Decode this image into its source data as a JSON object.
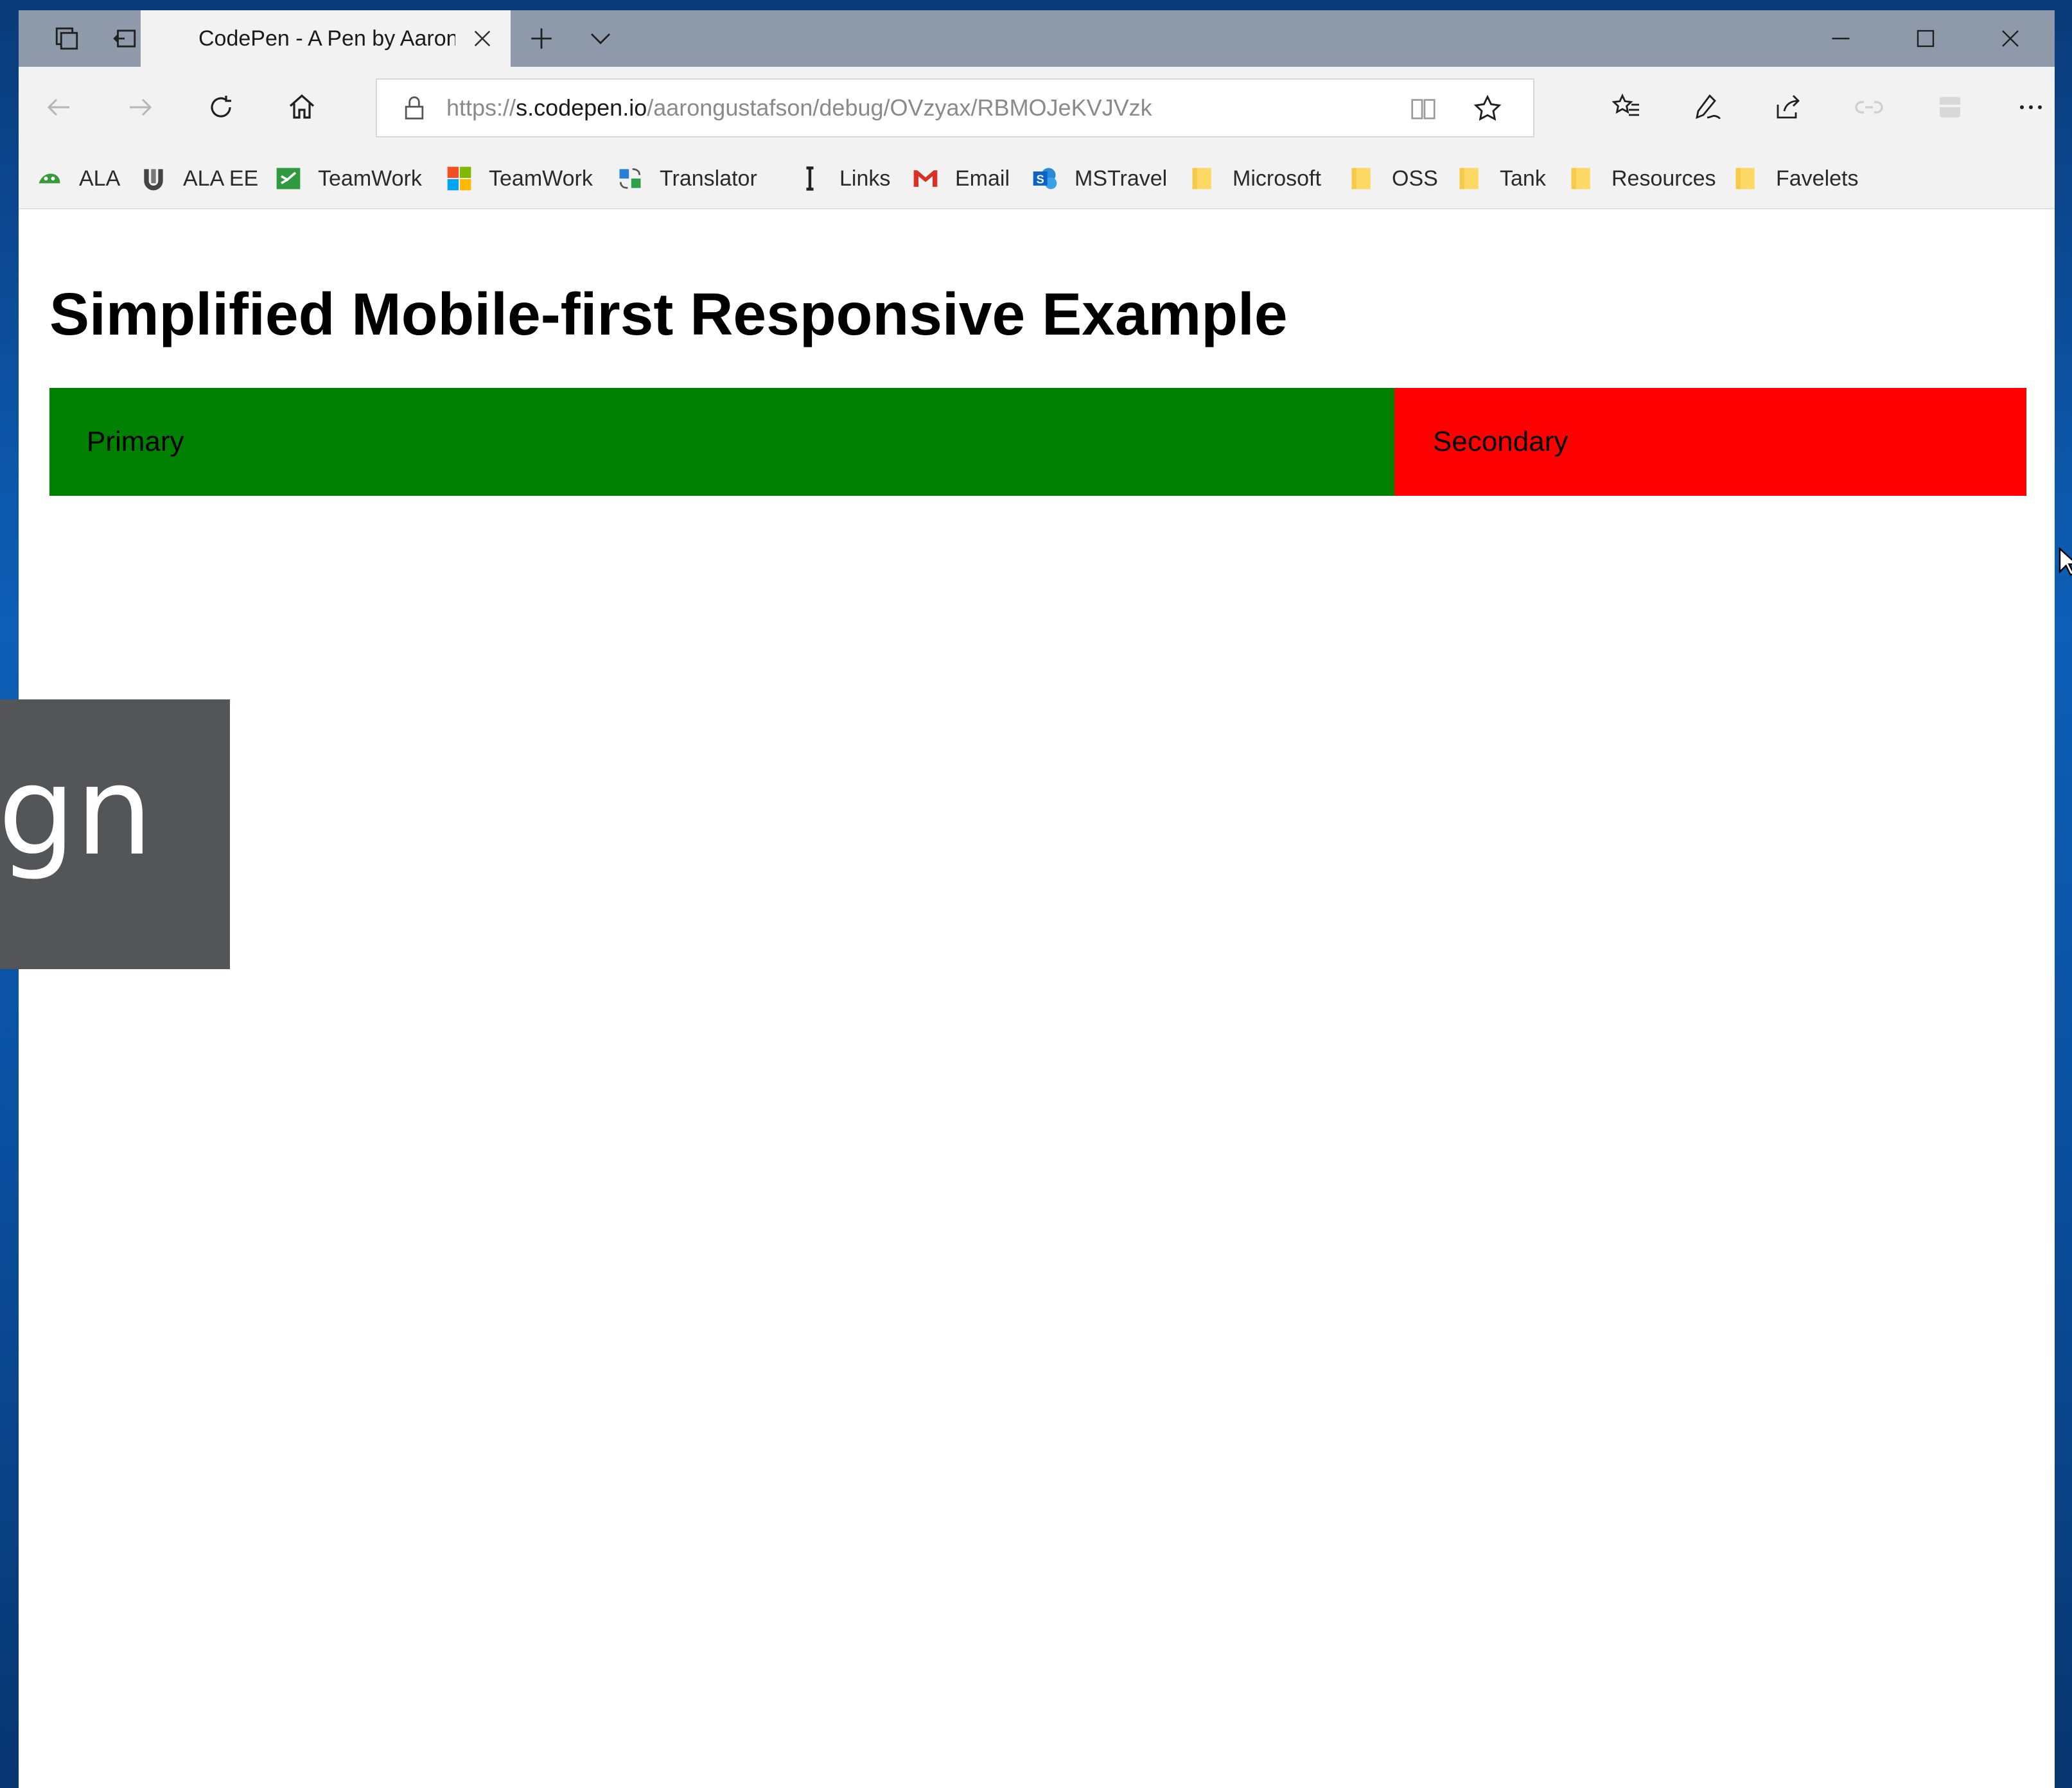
{
  "browser": {
    "tab": {
      "title": "CodePen - A Pen by Aaron Gustafson"
    },
    "address": {
      "protocol": "https://",
      "host": "s.codepen.io",
      "path": "/aarongustafson/debug/OVzyax/RBMOJeKVJVzk"
    },
    "favorites": [
      {
        "label": "ALA",
        "icon": "ala-icon",
        "color": "#3a9a3a"
      },
      {
        "label": "ALA EE",
        "icon": "ala-ee-icon",
        "color": "#444444"
      },
      {
        "label": "TeamWork",
        "icon": "teamwork-green-icon",
        "color": "#2f9a3f"
      },
      {
        "label": "TeamWork",
        "icon": "microsoft-logo-icon",
        "color": "#f25022"
      },
      {
        "label": "Translator",
        "icon": "translator-icon",
        "color": "#2a7fd4"
      },
      {
        "label": "Links",
        "icon": "links-icon",
        "color": "#222222"
      },
      {
        "label": "Email",
        "icon": "gmail-icon",
        "color": "#d93025"
      },
      {
        "label": "MSTravel",
        "icon": "sharepoint-icon",
        "color": "#0a64c8"
      },
      {
        "label": "Microsoft",
        "icon": "folder-icon",
        "color": "#f7c948"
      },
      {
        "label": "OSS",
        "icon": "folder-icon",
        "color": "#f7c948"
      },
      {
        "label": "Tank",
        "icon": "folder-icon",
        "color": "#f7c948"
      },
      {
        "label": "Resources",
        "icon": "folder-icon",
        "color": "#f7c948"
      },
      {
        "label": "Favelets",
        "icon": "folder-icon",
        "color": "#f7c948"
      }
    ]
  },
  "page": {
    "heading": "Simplified Mobile-first Responsive Example",
    "primary": {
      "label": "Primary",
      "color": "#008000"
    },
    "secondary": {
      "label": "Secondary",
      "color": "#ff0000"
    }
  },
  "overlay": {
    "text": "ign"
  }
}
